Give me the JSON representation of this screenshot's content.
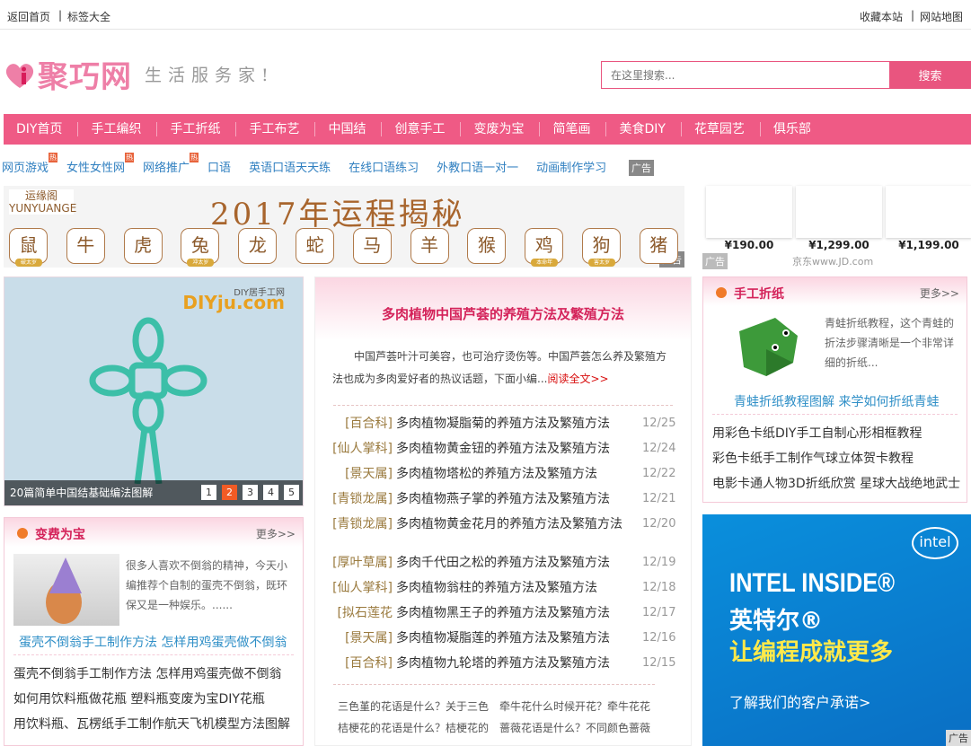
{
  "topbar": {
    "home": "返回首页",
    "tags": "标签大全",
    "favorite": "收藏本站",
    "sitemap": "网站地图"
  },
  "logo": {
    "name": "聚巧网",
    "slogan": "生活服务家!"
  },
  "search": {
    "placeholder": "在这里搜索...",
    "button": "搜索"
  },
  "nav": [
    "DIY首页",
    "手工编织",
    "手工折纸",
    "手工布艺",
    "中国结",
    "创意手工",
    "变废为宝",
    "简笔画",
    "美食DIY",
    "花草园艺",
    "俱乐部"
  ],
  "sublinks": [
    {
      "label": "网页游戏",
      "hot": "热"
    },
    {
      "label": "女性女性网",
      "hot": "热"
    },
    {
      "label": "网络推广",
      "hot": "热"
    },
    {
      "label": "口语"
    },
    {
      "label": "英语口语天天练"
    },
    {
      "label": "在线口语练习"
    },
    {
      "label": "外教口语一对一"
    },
    {
      "label": "动画制作学习"
    }
  ],
  "ad_label": "广告",
  "banner": {
    "brand": "运缘阁 YUNYUANGE",
    "title": "2017年运程揭秘",
    "zodiac": [
      {
        "c": "鼠",
        "b": "破太岁"
      },
      {
        "c": "牛"
      },
      {
        "c": "虎"
      },
      {
        "c": "兔",
        "b": "冲太岁"
      },
      {
        "c": "龙"
      },
      {
        "c": "蛇"
      },
      {
        "c": "马"
      },
      {
        "c": "羊"
      },
      {
        "c": "猴"
      },
      {
        "c": "鸡",
        "b": "本命年"
      },
      {
        "c": "狗",
        "b": "害太岁"
      },
      {
        "c": "猪"
      }
    ]
  },
  "jd": {
    "prices": [
      "¥190.00",
      "¥1,299.00",
      "¥1,199.00"
    ],
    "source": "京东www.JD.com"
  },
  "slide": {
    "watermark": "DIYju.com",
    "watermark_sub": "DIY居手工网",
    "caption": "20篇简单中国结基础编法图解",
    "pages": [
      "1",
      "2",
      "3",
      "4",
      "5"
    ],
    "active": 2
  },
  "featured": {
    "title": "多肉植物中国芦荟的养殖方法及繁殖方法",
    "intro": "中国芦荟叶汁可美容，也可治疗烫伤等。中国芦荟怎么养及繁殖方法也成为多肉爱好者的热议话题，下面小编...",
    "read_more": "阅读全文>>"
  },
  "list1": [
    {
      "cat": "[百合科]",
      "title": "多肉植物凝脂菊的养殖方法及繁殖方法",
      "date": "12/25"
    },
    {
      "cat": "[仙人掌科]",
      "title": "多肉植物黄金钮的养殖方法及繁殖方法",
      "date": "12/24"
    },
    {
      "cat": "[景天属]",
      "title": "多肉植物塔松的养殖方法及繁殖方法",
      "date": "12/22"
    },
    {
      "cat": "[青锁龙属]",
      "title": "多肉植物燕子掌的养殖方法及繁殖方法",
      "date": "12/21"
    },
    {
      "cat": "[青锁龙属]",
      "title": "多肉植物黄金花月的养殖方法及繁殖方法",
      "date": "12/20"
    }
  ],
  "list2": [
    {
      "cat": "[厚叶草属]",
      "title": "多肉千代田之松的养殖方法及繁殖方法",
      "date": "12/19"
    },
    {
      "cat": "[仙人掌科]",
      "title": "多肉植物翁柱的养殖方法及繁殖方法",
      "date": "12/18"
    },
    {
      "cat": "[拟石莲花",
      "title": "多肉植物黑王子的养殖方法及繁殖方法",
      "date": "12/17"
    },
    {
      "cat": "[景天属]",
      "title": "多肉植物凝脂莲的养殖方法及繁殖方法",
      "date": "12/16"
    },
    {
      "cat": "[百合科]",
      "title": "多肉植物九轮塔的养殖方法及繁殖方法",
      "date": "12/15"
    }
  ],
  "flower_links": [
    "三色堇的花语是什么？关于三色",
    "牵牛花什么时候开花？牵牛花花",
    "桔梗花的花语是什么？桔梗花的",
    "蔷薇花语是什么？不同颜色蔷薇"
  ],
  "origami": {
    "title": "手工折纸",
    "more": "更多>>",
    "desc": "青蛙折纸教程，这个青蛙的折法步骤清晰是一个非常详细的折纸...",
    "headline": "青蛙折纸教程图解 来学如何折纸青蛙",
    "links": [
      "用彩色卡纸DIY手工自制心形相框教程",
      "彩色卡纸手工制作气球立体贺卡教程",
      "电影卡通人物3D折纸欣赏 星球大战绝地武士"
    ]
  },
  "recycle": {
    "title": "变费为宝",
    "more": "更多>>",
    "desc": "很多人喜欢不倒翁的精神，今天小编推荐个自制的蛋壳不倒翁，既环保又是一种娱乐。......",
    "headline": "蛋壳不倒翁手工制作方法 怎样用鸡蛋壳做不倒翁",
    "links": [
      "蛋壳不倒翁手工制作方法 怎样用鸡蛋壳做不倒翁",
      "如何用饮料瓶做花瓶 塑料瓶变废为宝DIY花瓶",
      "用饮料瓶、瓦楞纸手工制作航天飞机模型方法图解"
    ]
  },
  "intel": {
    "brand": "intel",
    "line1": "INTEL INSIDE®",
    "line2": "英特尔®",
    "line3": "让编程成就更多",
    "cta": "了解我们的客户承诺>"
  },
  "colors": {
    "brand_pink": "#ef5a85",
    "title_red": "#d4235a",
    "link_blue": "#2f7fc0",
    "category_gold": "#9a7a3e"
  }
}
